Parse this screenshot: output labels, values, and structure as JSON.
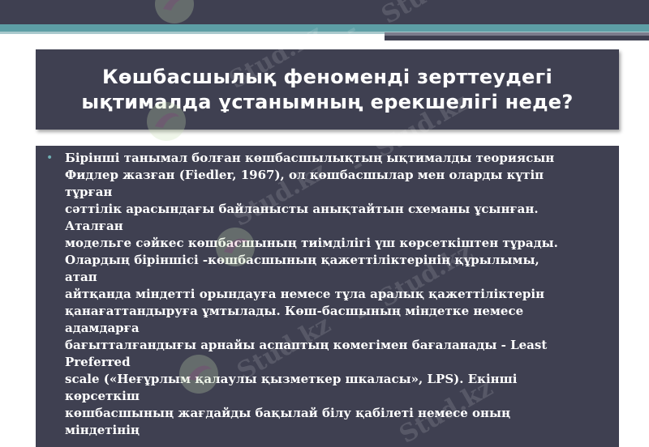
{
  "slide": {
    "title": "Көшбасшылық феноменді зерттеудегі ықтималда ұстанымның ерекшелігі неде?",
    "bullet": "•",
    "body_lines": [
      "Бірінші танымал болған көшбасшылықтың ықтималды теориясын",
      "Фидлер жазған (Fiedler, 1967), ол көшбасшылар мен оларды күтіп",
      "тұрған",
      "сәттілік арасындағы байланысты анықтайтын схеманы ұсынған.",
      "Аталған",
      "модельге сәйкес көшбасшының тиімділігі үш көрсеткіштен тұрады.",
      "Олардың біріншісі -көшбасшының қажеттіліктерінің құрылымы,",
      "атап",
      "айтқанда міндетті орындауға немесе тұла аралық қажеттіліктерін",
      "қанағаттандыруға ұмтылады. Көш-басшының міндетке немесе",
      "адамдарға",
      "бағытталғандығы арнайы аспаптың көмегімен бағаланады - Least",
      "Preferred",
      "scale («Неғұрлым қалаулы қызметкер шкаласы», LPS). Екінші",
      "көрсеткіш",
      "көшбасшының жағдайды бақылай білу қабілеті немесе оның",
      "міндетінің"
    ]
  },
  "watermark": {
    "text": "Stud.kz",
    "dash": "-"
  },
  "colors": {
    "panel": "#3f4051",
    "accent": "#5d9ea5",
    "text": "#ffffff"
  }
}
